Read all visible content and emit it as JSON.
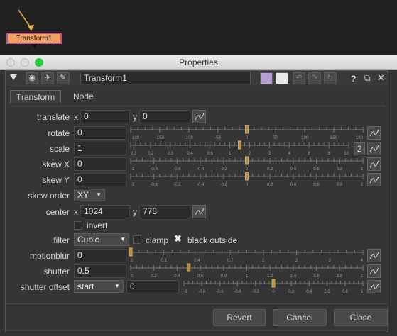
{
  "node": {
    "label": "Transform1"
  },
  "window": {
    "title": "Properties"
  },
  "toolbar": {
    "node_name": "Transform1",
    "help": "?"
  },
  "tabs": [
    {
      "label": "Transform"
    },
    {
      "label": "Node"
    }
  ],
  "knobs": {
    "translate": {
      "label": "translate",
      "x_label": "x",
      "x": "0",
      "y_label": "y",
      "y": "0"
    },
    "rotate": {
      "label": "rotate",
      "value": "0",
      "ticks": [
        "-180",
        "-150",
        "-100",
        "-50",
        "0",
        "50",
        "100",
        "150",
        "180"
      ],
      "level": 0.5
    },
    "scale": {
      "label": "scale",
      "value": "1",
      "ticks": [
        "0.1",
        "0.2",
        "0.3",
        "0.4",
        "0.6",
        "1",
        "2",
        "3",
        "4",
        "6",
        "8",
        "10"
      ],
      "level": 0.5,
      "channel_btn": "2"
    },
    "skewX": {
      "label": "skew X",
      "value": "0",
      "ticks": [
        "-1",
        "-0.8",
        "-0.6",
        "-0.4",
        "-0.2",
        "0",
        "0.2",
        "0.4",
        "0.6",
        "0.8",
        "1"
      ],
      "level": 0.5
    },
    "skewY": {
      "label": "skew Y",
      "value": "0",
      "ticks": [
        "-1",
        "-0.8",
        "-0.6",
        "-0.4",
        "-0.2",
        "0",
        "0.2",
        "0.4",
        "0.6",
        "0.8",
        "1"
      ],
      "level": 0.5
    },
    "skew_order": {
      "label": "skew order",
      "value": "XY"
    },
    "center": {
      "label": "center",
      "x_label": "x",
      "x": "1024",
      "y_label": "y",
      "y": "778"
    },
    "invert": {
      "label": "invert"
    },
    "filter": {
      "label": "filter",
      "value": "Cubic",
      "clamp": "clamp",
      "black_outside": "black outside"
    },
    "motionblur": {
      "label": "motionblur",
      "value": "0",
      "ticks": [
        "0",
        "0.1",
        "0.4",
        "0.7",
        "1",
        "2",
        "3",
        "4"
      ],
      "level": 0.0
    },
    "shutter": {
      "label": "shutter",
      "value": "0.5",
      "ticks": [
        "0",
        "0.2",
        "0.4",
        "0.6",
        "0.8",
        "1",
        "1.2",
        "1.4",
        "1.6",
        "1.8",
        "2"
      ],
      "level": 0.25
    },
    "shutter_offset": {
      "label": "shutter offset",
      "mode": "start",
      "value": "0",
      "ticks": [
        "-1",
        "-0.8",
        "-0.6",
        "-0.4",
        "-0.2",
        "0",
        "0.2",
        "0.4",
        "0.6",
        "0.8",
        "1"
      ],
      "level": 0.5
    }
  },
  "buttons": {
    "revert": "Revert",
    "cancel": "Cancel",
    "close": "Close"
  },
  "colors": {
    "node_fill": "#f3a05e",
    "node_border": "#c0508a",
    "arrow": "#f1b24a",
    "panel_bg": "#353535"
  }
}
